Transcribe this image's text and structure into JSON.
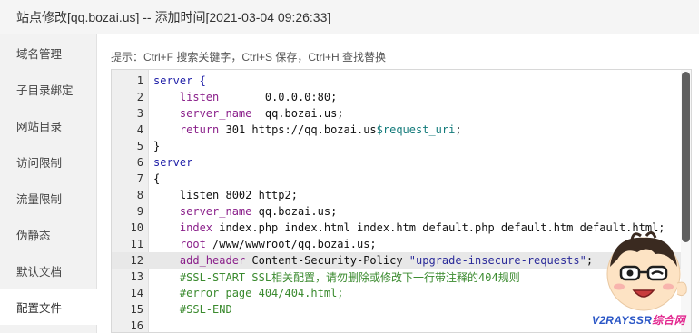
{
  "window": {
    "title": "站点修改[qq.bozai.us] -- 添加时间[2021-03-04 09:26:33]"
  },
  "sidebar": {
    "items": [
      {
        "label": "域名管理"
      },
      {
        "label": "子目录绑定"
      },
      {
        "label": "网站目录"
      },
      {
        "label": "访问限制"
      },
      {
        "label": "流量限制"
      },
      {
        "label": "伪静态"
      },
      {
        "label": "默认文档"
      },
      {
        "label": "配置文件"
      }
    ],
    "active": "配置文件"
  },
  "hint": "提示：Ctrl+F 搜索关键字，Ctrl+S 保存，Ctrl+H 查找替换",
  "editor": {
    "active_line": 12,
    "lines": [
      {
        "n": "1",
        "tokens": [
          {
            "t": "server {",
            "c": "kw"
          }
        ]
      },
      {
        "n": "2",
        "tokens": [
          {
            "t": "    "
          },
          {
            "t": "listen",
            "c": "dir"
          },
          {
            "t": "       0.0.0.0:80;"
          }
        ]
      },
      {
        "n": "3",
        "tokens": [
          {
            "t": "    "
          },
          {
            "t": "server_name",
            "c": "dir"
          },
          {
            "t": "  qq.bozai.us;"
          }
        ]
      },
      {
        "n": "4",
        "tokens": [
          {
            "t": "    "
          },
          {
            "t": "return",
            "c": "dir"
          },
          {
            "t": " 301 https://qq.bozai.us"
          },
          {
            "t": "$request_uri",
            "c": "var"
          },
          {
            "t": ";"
          }
        ]
      },
      {
        "n": "5",
        "tokens": [
          {
            "t": "}"
          }
        ]
      },
      {
        "n": "6",
        "tokens": [
          {
            "t": "server",
            "c": "kw"
          }
        ]
      },
      {
        "n": "7",
        "tokens": [
          {
            "t": "{"
          }
        ]
      },
      {
        "n": "8",
        "tokens": [
          {
            "t": "    listen 8002 http2;"
          }
        ]
      },
      {
        "n": "9",
        "tokens": [
          {
            "t": "    "
          },
          {
            "t": "server_name",
            "c": "dir"
          },
          {
            "t": " qq.bozai.us;"
          }
        ]
      },
      {
        "n": "10",
        "tokens": [
          {
            "t": "    "
          },
          {
            "t": "index",
            "c": "dir"
          },
          {
            "t": " index.php index.html index.htm default.php default.htm default.html;"
          }
        ]
      },
      {
        "n": "11",
        "tokens": [
          {
            "t": "    "
          },
          {
            "t": "root",
            "c": "dir"
          },
          {
            "t": " /www/wwwroot/qq.bozai.us;"
          }
        ]
      },
      {
        "n": "12",
        "tokens": [
          {
            "t": "    "
          },
          {
            "t": "add_header",
            "c": "dir"
          },
          {
            "t": " Content-Security-Policy "
          },
          {
            "t": "\"upgrade-insecure-requests\"",
            "c": "str"
          },
          {
            "t": ";"
          }
        ]
      },
      {
        "n": "13",
        "tokens": [
          {
            "t": "    "
          },
          {
            "t": "#SSL-START SSL相关配置，请勿删除或修改下一行带注释的404规则",
            "c": "cm"
          }
        ]
      },
      {
        "n": "14",
        "tokens": [
          {
            "t": "    "
          },
          {
            "t": "#error_page 404/404.html;",
            "c": "cm"
          }
        ]
      },
      {
        "n": "15",
        "tokens": [
          {
            "t": "    "
          },
          {
            "t": "#SSL-END",
            "c": "cm"
          }
        ]
      },
      {
        "n": "16",
        "tokens": []
      }
    ]
  },
  "watermark": {
    "brand": "V2RAYSSR",
    "suffix": "综合网"
  },
  "colors": {
    "keyword": "#2020a8",
    "directive": "#8a1f8a",
    "variable": "#127a7a",
    "string": "#2b2b9a",
    "comment": "#3a8a2e",
    "active_line_bg": "#e8e8e8"
  }
}
